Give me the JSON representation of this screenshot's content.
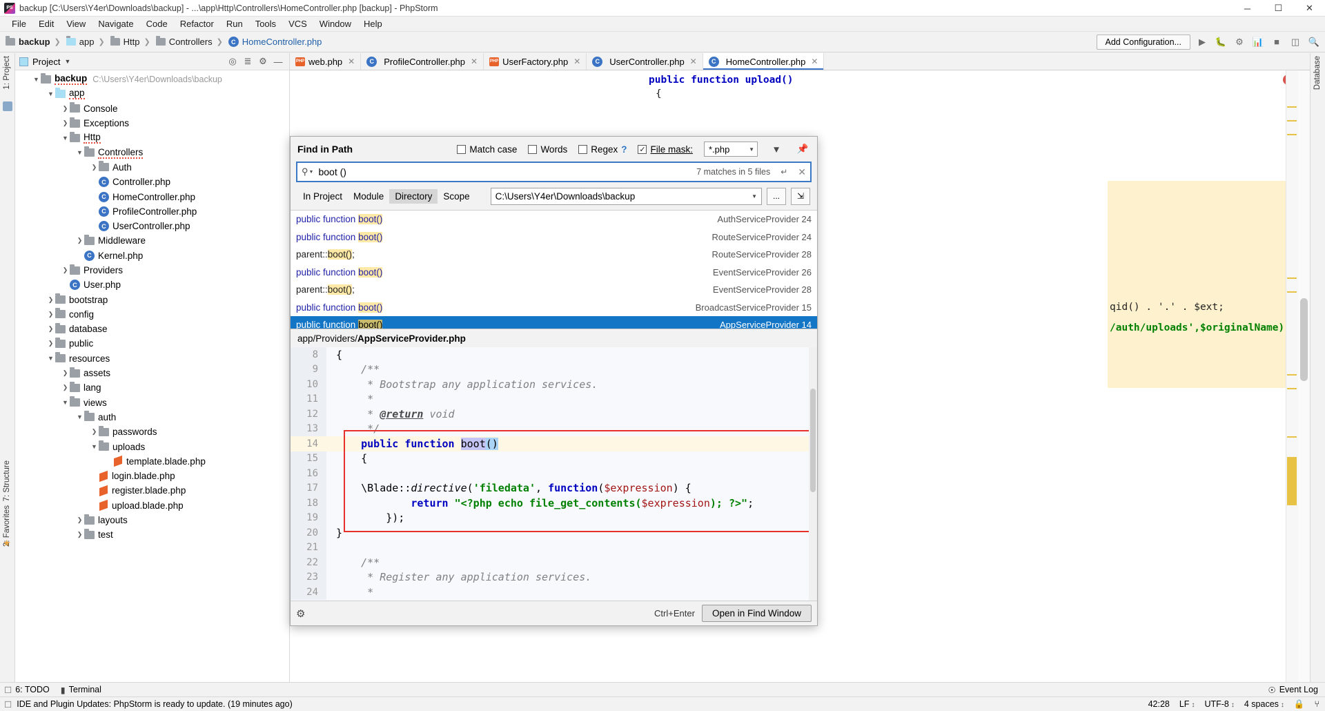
{
  "window": {
    "title": "backup [C:\\Users\\Y4er\\Downloads\\backup] - ...\\app\\Http\\Controllers\\HomeController.php [backup] - PhpStorm",
    "minimize": "─",
    "maximize": "☐",
    "close": "✕"
  },
  "menu": [
    "File",
    "Edit",
    "View",
    "Navigate",
    "Code",
    "Refactor",
    "Run",
    "Tools",
    "VCS",
    "Window",
    "Help"
  ],
  "navbar": {
    "crumbs": [
      "backup",
      "app",
      "Http",
      "Controllers",
      "HomeController.php"
    ],
    "add_configuration": "Add Configuration...",
    "icons": [
      "run-icon",
      "debug-icon",
      "coverage-icon",
      "profile-icon",
      "stop-icon",
      "layout-icon",
      "search-everywhere-icon"
    ]
  },
  "project_panel": {
    "header": "Project",
    "root": {
      "label": "backup",
      "path": "C:\\Users\\Y4er\\Downloads\\backup"
    },
    "tree": [
      {
        "label": "app",
        "indent": 1,
        "type": "folder-blue",
        "state": "open"
      },
      {
        "label": "Console",
        "indent": 2,
        "type": "folder",
        "state": "closed"
      },
      {
        "label": "Exceptions",
        "indent": 2,
        "type": "folder",
        "state": "closed"
      },
      {
        "label": "Http",
        "indent": 2,
        "type": "folder",
        "state": "open"
      },
      {
        "label": "Controllers",
        "indent": 3,
        "type": "folder",
        "state": "open"
      },
      {
        "label": "Auth",
        "indent": 4,
        "type": "folder",
        "state": "closed"
      },
      {
        "label": "Controller.php",
        "indent": 4,
        "type": "php-class",
        "state": "leaf"
      },
      {
        "label": "HomeController.php",
        "indent": 4,
        "type": "php-class",
        "state": "leaf",
        "selected": false
      },
      {
        "label": "ProfileController.php",
        "indent": 4,
        "type": "php-class",
        "state": "leaf"
      },
      {
        "label": "UserController.php",
        "indent": 4,
        "type": "php-class",
        "state": "leaf"
      },
      {
        "label": "Middleware",
        "indent": 3,
        "type": "folder",
        "state": "closed"
      },
      {
        "label": "Kernel.php",
        "indent": 3,
        "type": "php-class",
        "state": "leaf"
      },
      {
        "label": "Providers",
        "indent": 2,
        "type": "folder",
        "state": "closed"
      },
      {
        "label": "User.php",
        "indent": 2,
        "type": "php-class",
        "state": "leaf"
      },
      {
        "label": "bootstrap",
        "indent": 1,
        "type": "folder",
        "state": "closed"
      },
      {
        "label": "config",
        "indent": 1,
        "type": "folder",
        "state": "closed"
      },
      {
        "label": "database",
        "indent": 1,
        "type": "folder",
        "state": "closed"
      },
      {
        "label": "public",
        "indent": 1,
        "type": "folder",
        "state": "closed"
      },
      {
        "label": "resources",
        "indent": 1,
        "type": "folder",
        "state": "open"
      },
      {
        "label": "assets",
        "indent": 2,
        "type": "folder",
        "state": "closed"
      },
      {
        "label": "lang",
        "indent": 2,
        "type": "folder",
        "state": "closed"
      },
      {
        "label": "views",
        "indent": 2,
        "type": "folder",
        "state": "open"
      },
      {
        "label": "auth",
        "indent": 3,
        "type": "folder",
        "state": "open"
      },
      {
        "label": "passwords",
        "indent": 4,
        "type": "folder",
        "state": "closed"
      },
      {
        "label": "uploads",
        "indent": 4,
        "type": "folder",
        "state": "open"
      },
      {
        "label": "template.blade.php",
        "indent": 5,
        "type": "blade",
        "state": "leaf"
      },
      {
        "label": "login.blade.php",
        "indent": 4,
        "type": "blade",
        "state": "leaf"
      },
      {
        "label": "register.blade.php",
        "indent": 4,
        "type": "blade",
        "state": "leaf"
      },
      {
        "label": "upload.blade.php",
        "indent": 4,
        "type": "blade",
        "state": "leaf"
      },
      {
        "label": "layouts",
        "indent": 3,
        "type": "folder",
        "state": "closed"
      },
      {
        "label": "test",
        "indent": 3,
        "type": "folder",
        "state": "closed"
      }
    ]
  },
  "editor_tabs": [
    {
      "label": "web.php",
      "icon": "blade-icon",
      "active": false
    },
    {
      "label": "ProfileController.php",
      "icon": "php-class-icon",
      "active": false
    },
    {
      "label": "UserFactory.php",
      "icon": "blade-icon",
      "active": false
    },
    {
      "label": "UserController.php",
      "icon": "php-class-icon",
      "active": false
    },
    {
      "label": "HomeController.php",
      "icon": "php-class-icon",
      "active": true
    }
  ],
  "editor_background": {
    "line_a": "public function upload()",
    "line_b": "{",
    "line_c": "qid() . '.' . $ext;",
    "line_d": "/auth/uploads',$originalName);"
  },
  "find_dialog": {
    "title": "Find in Path",
    "options": [
      {
        "label": "Match case",
        "checked": false,
        "mnemonic": "c"
      },
      {
        "label": "Words",
        "checked": false,
        "mnemonic": "o"
      },
      {
        "label": "Regex",
        "checked": false,
        "mnemonic": "x",
        "help": "?"
      },
      {
        "label": "File mask:",
        "checked": true,
        "mnemonic": "m"
      }
    ],
    "file_mask_value": "*.php",
    "filter_icon": "filter-icon",
    "pin_icon": "pin-icon",
    "search_icon": "search-icon",
    "query": "boot ()",
    "matches_label": "7 matches in 5 files",
    "enter_icon": "↵",
    "clear_icon": "✕",
    "scope_tabs": [
      {
        "label": "In Project",
        "mnemonic": "P",
        "active": false
      },
      {
        "label": "Module",
        "mnemonic": "M",
        "active": false
      },
      {
        "label": "Directory",
        "mnemonic": "D",
        "active": true
      },
      {
        "label": "Scope",
        "mnemonic": "S",
        "active": false
      }
    ],
    "directory_path": "C:\\Users\\Y4er\\Downloads\\backup",
    "browse_button": "...",
    "recursive_icon": "recursive-icon",
    "results": [
      {
        "pre": "public function ",
        "match": "boot()",
        "post": "",
        "file": "AuthServiceProvider",
        "line": "24",
        "selected": false,
        "plain": false
      },
      {
        "pre": "public function ",
        "match": "boot()",
        "post": "",
        "file": "RouteServiceProvider",
        "line": "24",
        "selected": false,
        "plain": false
      },
      {
        "pre": "parent::",
        "match": "boot()",
        "post": ";",
        "file": "RouteServiceProvider",
        "line": "28",
        "selected": false,
        "plain": true
      },
      {
        "pre": "public function ",
        "match": "boot()",
        "post": "",
        "file": "EventServiceProvider",
        "line": "26",
        "selected": false,
        "plain": false
      },
      {
        "pre": "parent::",
        "match": "boot()",
        "post": ";",
        "file": "EventServiceProvider",
        "line": "28",
        "selected": false,
        "plain": true
      },
      {
        "pre": "public function ",
        "match": "boot()",
        "post": "",
        "file": "BroadcastServiceProvider",
        "line": "15",
        "selected": false,
        "plain": false
      },
      {
        "pre": "public function ",
        "match": "boot()",
        "post": "",
        "file": "AppServiceProvider",
        "line": "14",
        "selected": true,
        "plain": false
      }
    ],
    "preview_path_prefix": "app/Providers/",
    "preview_path_file": "AppServiceProvider.php",
    "preview_lines": [
      {
        "n": "8",
        "html": "{"
      },
      {
        "n": "9",
        "html": "    <span class='cm'>/**</span>"
      },
      {
        "n": "10",
        "html": "     <span class='cm'>* Bootstrap any application services.</span>"
      },
      {
        "n": "11",
        "html": "     <span class='cm'>*</span>"
      },
      {
        "n": "12",
        "html": "     <span class='cm'>* </span><span class='cmt'>@return</span><span class='cm'> void</span>"
      },
      {
        "n": "13",
        "html": "     <span class='cm'>*/</span>"
      },
      {
        "n": "14",
        "html": "    <span class='kw'>public function</span> <span class='selblue'>boot</span><span class='selblue2'>()</span>",
        "current": true
      },
      {
        "n": "15",
        "html": "    {"
      },
      {
        "n": "16",
        "html": ""
      },
      {
        "n": "17",
        "html": "    \\<span class='cls'>Blade</span>::<span class='ital'>directive</span>(<span class='str'>'filedata'</span>, <span class='kw'>function</span>(<span class='var'>$expression</span>) {"
      },
      {
        "n": "18",
        "html": "            <span class='kw'>return</span> <span class='str'>\"&lt;?php echo file_get_contents(</span><span class='var'>$expression</span><span class='str'>); ?&gt;\"</span>;"
      },
      {
        "n": "19",
        "html": "        });"
      },
      {
        "n": "20",
        "html": "}"
      },
      {
        "n": "21",
        "html": ""
      },
      {
        "n": "22",
        "html": "    <span class='cm'>/**</span>"
      },
      {
        "n": "23",
        "html": "     <span class='cm'>* Register any application services.</span>"
      },
      {
        "n": "24",
        "html": "     <span class='cm'>*</span>"
      }
    ],
    "footer": {
      "settings_icon": "gear-icon",
      "shortcut": "Ctrl+Enter",
      "open_button": "Open in Find Window"
    }
  },
  "tool_windows": {
    "left": [
      {
        "label": "6: TODO",
        "icon": "todo-icon"
      },
      {
        "label": "Terminal",
        "icon": "terminal-icon"
      }
    ],
    "right": [
      {
        "label": "Event Log",
        "icon": "eventlog-icon"
      }
    ]
  },
  "status_bar": {
    "message": "IDE and Plugin Updates: PhpStorm is ready to update. (19 minutes ago)",
    "caret": "42:28",
    "line_sep": "LF",
    "encoding": "UTF-8",
    "indent": "4 spaces",
    "lock_icon": "lock-icon",
    "branch_icon": "branch-icon"
  },
  "rails": {
    "left_top": "1: Project",
    "left_mid": "7: Structure",
    "left_bottom": "2: Favorites",
    "right_top": "Database"
  }
}
